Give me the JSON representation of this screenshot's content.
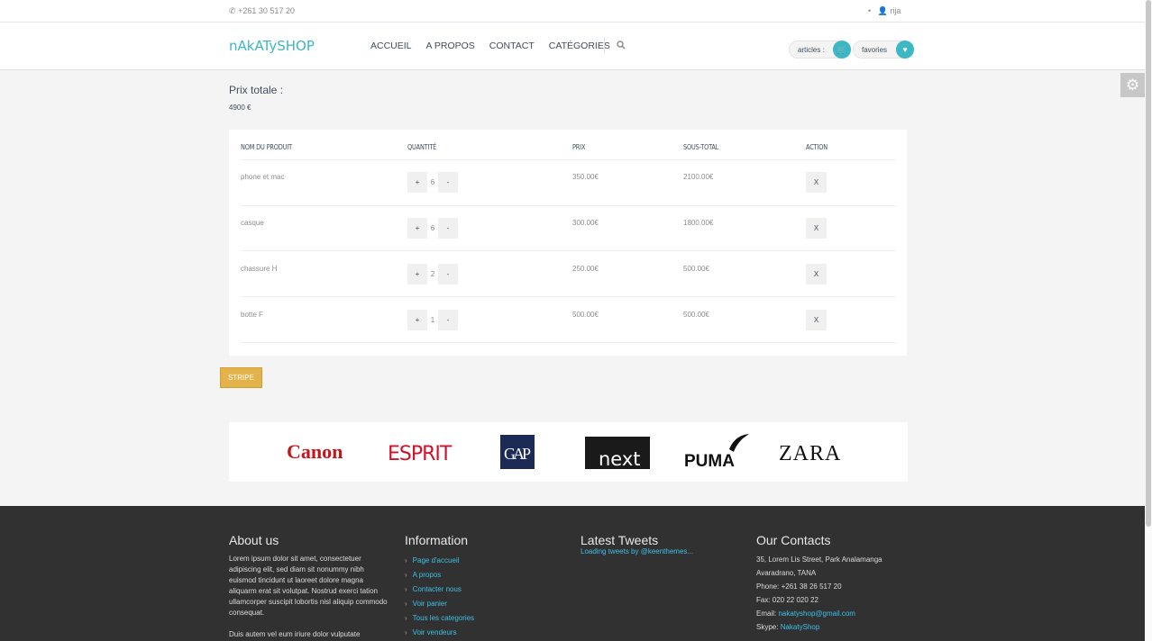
{
  "topbar": {
    "phone": "+261 30 517 20",
    "user": "rija"
  },
  "header": {
    "logo": "nAkATySHOP",
    "nav": [
      "ACCUEIL",
      "A PROPOS",
      "CONTACT",
      "CATÉGORIES"
    ],
    "articles_label": "articles :",
    "favorites_label": "favories"
  },
  "accent_color": "#3bb8c4",
  "total": {
    "label": "Prix totale :",
    "value": "4900 €"
  },
  "cart": {
    "headers": [
      "NOM DU PRODUIT",
      "QUANTITÉ",
      "PRIX",
      "SOUS-TOTAL",
      "ACTION"
    ],
    "rows": [
      {
        "name": "phone et mac",
        "qty": "6",
        "price": "350.00€",
        "subtotal": "2100.00€"
      },
      {
        "name": "casque",
        "qty": "6",
        "price": "300.00€",
        "subtotal": "1800.00€"
      },
      {
        "name": "chassure H",
        "qty": "2",
        "price": "250.00€",
        "subtotal": "500.00€"
      },
      {
        "name": "botte F",
        "qty": "1",
        "price": "500.00€",
        "subtotal": "500.00€"
      }
    ],
    "plus": "+",
    "minus": "-",
    "delete": "X"
  },
  "stripe_button": "STRIPE",
  "brands": [
    "Canon",
    "ESPRIT",
    "GAP",
    "next",
    "PUMA",
    "ZARA"
  ],
  "footer": {
    "about": {
      "title": "About us",
      "p1": "Lorem ipsum dolor sit amet, consectetuer adipiscing elit, sed diam sit nonummy nibh euismod tincidunt ut laoreet dolore magna aliquarm erat sit volutpat. Nostrud exerci tation ullamcorper suscipit lobortis nisl aliquip commodo consequat.",
      "p2": "Duis autem vel eum iriure dolor vulputate"
    },
    "information": {
      "title": "Information",
      "links": [
        "Page d'accueil",
        "A propos",
        "Contacter nous",
        "Voir panier",
        "Tous les categories",
        "Voir vendeurs"
      ]
    },
    "tweets": {
      "title": "Latest Tweets",
      "loading": "Loading tweets by @keenthemes..."
    },
    "contacts": {
      "title": "Our Contacts",
      "address1": "35, Lorem Lis Street, Park Analamanga",
      "address2": "Avaradrano, TANA",
      "phone": "Phone: +261 38 26 517 20",
      "fax": "Fax: 020 22 020 22",
      "email_label": "Email:",
      "email": "nakatyshop@gmail.com",
      "skype_label": "Skype:",
      "skype": "NakatyShop"
    }
  }
}
